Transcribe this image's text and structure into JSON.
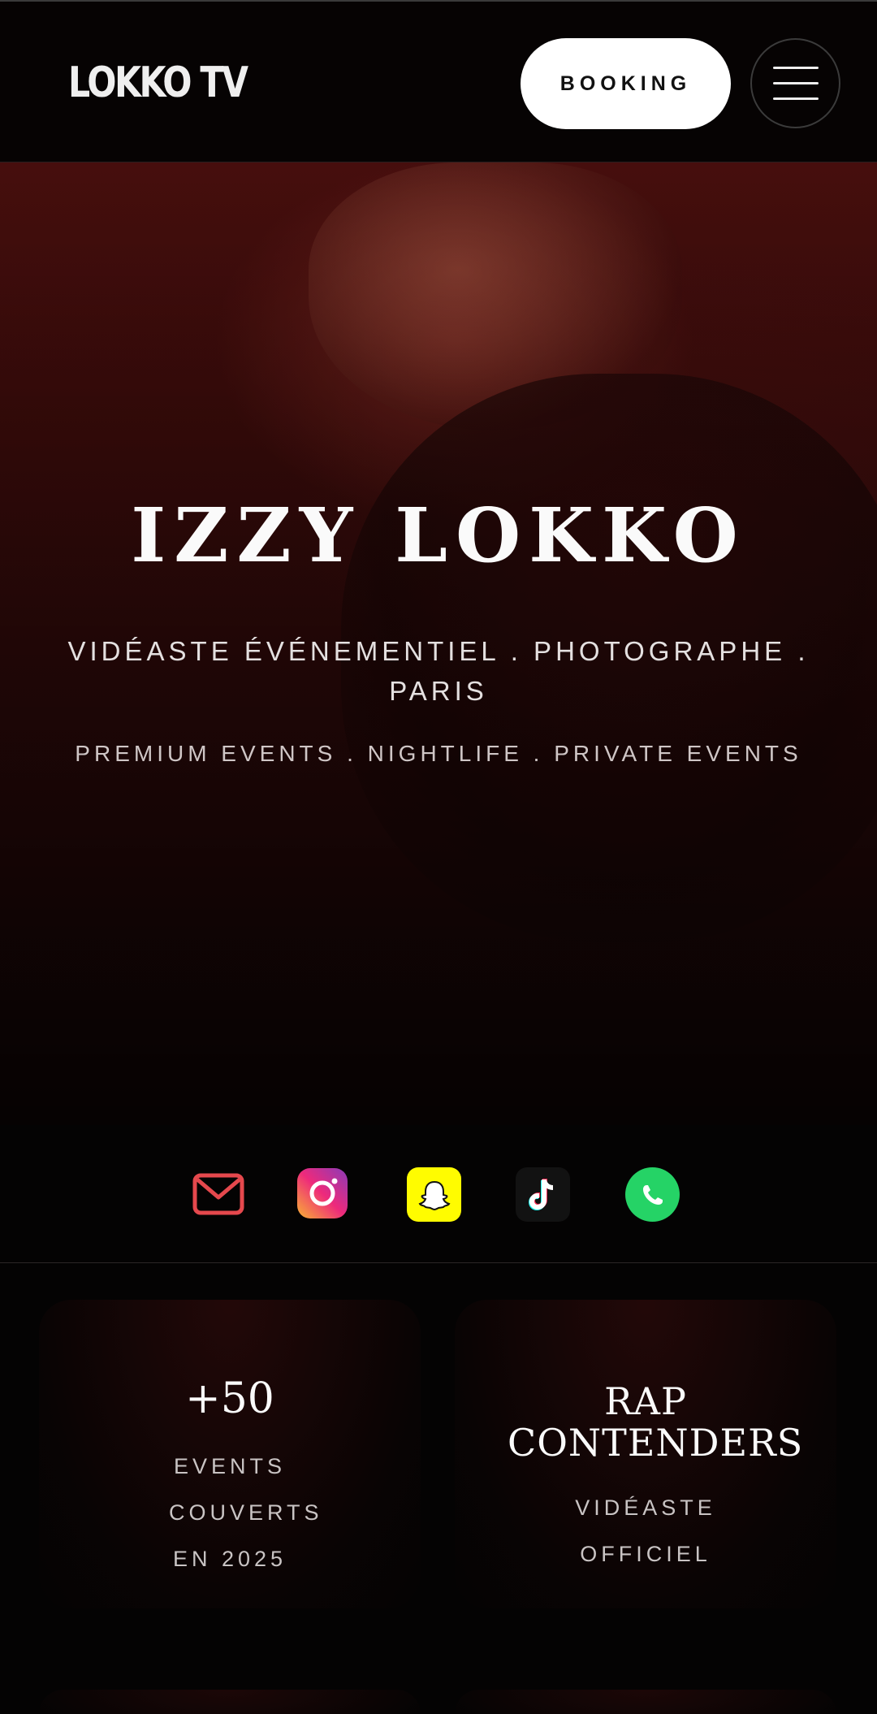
{
  "header": {
    "logo": "LOKKO TV",
    "booking_label": "BOOKING"
  },
  "hero": {
    "title": "IZZY LOKKO",
    "subtitle": "VIDÉASTE ÉVÉNEMENTIEL . PHOTOGRAPHE . PARIS",
    "tagline": "PREMIUM EVENTS . NIGHTLIFE . PRIVATE EVENTS"
  },
  "socials": [
    {
      "icon": "mail-icon",
      "color": "#e5484d"
    },
    {
      "icon": "instagram-icon",
      "color": "#ee2a7b"
    },
    {
      "icon": "snapchat-icon",
      "color": "#fffc00"
    },
    {
      "icon": "tiktok-icon",
      "color": "#121212"
    },
    {
      "icon": "whatsapp-icon",
      "color": "#25d366"
    }
  ],
  "stats": {
    "events": {
      "value": "+50",
      "label": "EVENTS COUVERTS EN 2025"
    },
    "rap": {
      "title": "RAP CONTENDERS",
      "label": "VIDÉASTE OFFICIEL"
    }
  },
  "colors": {
    "background": "#040303",
    "accent": "#4a0f0e"
  }
}
